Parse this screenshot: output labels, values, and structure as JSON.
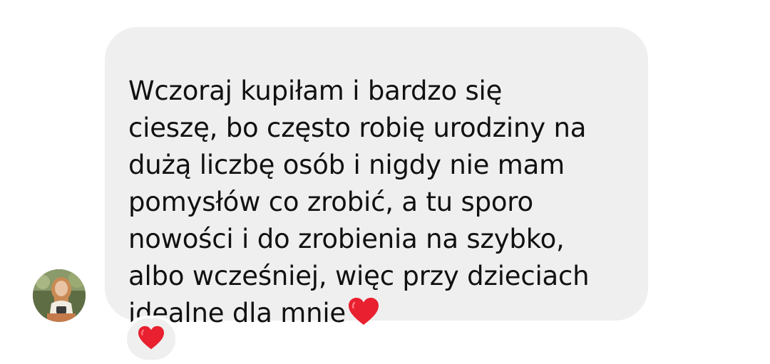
{
  "message": {
    "text": "Wczoraj kupiłam i bardzo się\ncieszę, bo często robię urodziny na\ndużą liczbę osób i nigdy nie mam\npomysłów co zrobić, a tu sporo\nnowości i do zrobienia na szybko,\nalbo wcześniej, więc przy dzieciach\nidealne dla mnie",
    "trailing_emoji_icon": "red-heart-icon",
    "bubble_color": "#efefef",
    "text_color": "#111111"
  },
  "sender": {
    "avatar_icon": "avatar"
  },
  "reaction": {
    "icon": "red-heart-icon",
    "color": "#e8202f"
  }
}
